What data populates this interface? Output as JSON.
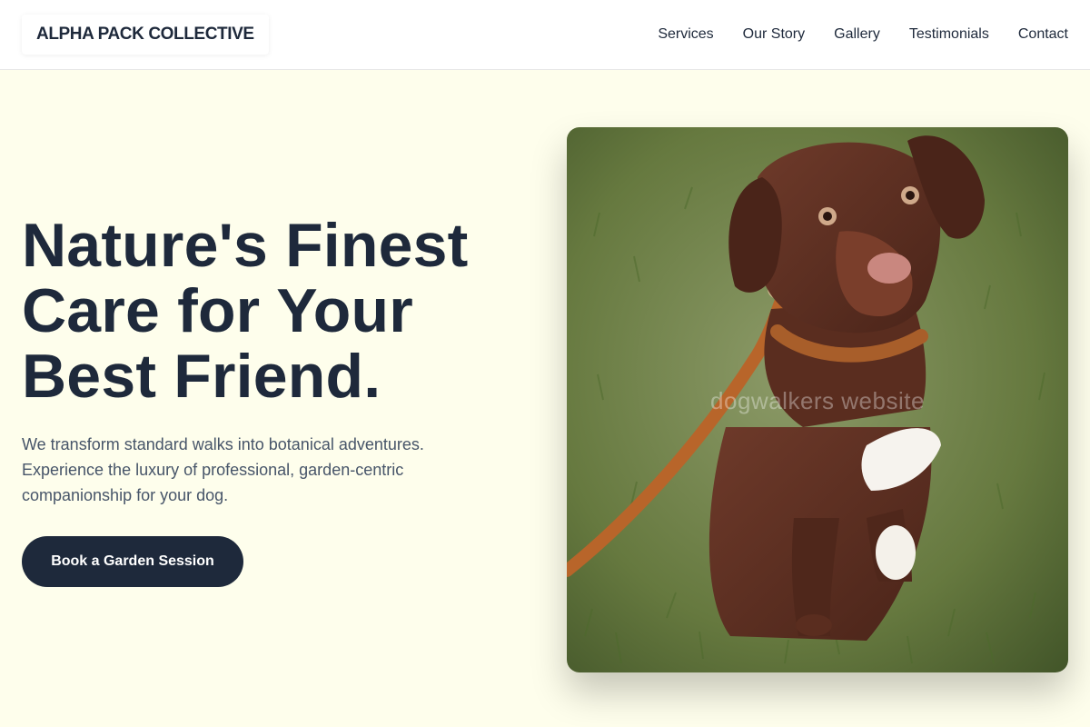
{
  "header": {
    "logo": "ALPHA PACK COLLECTIVE",
    "nav": [
      "Services",
      "Our Story",
      "Gallery",
      "Testimonials",
      "Contact"
    ]
  },
  "hero": {
    "title_lines": [
      "Nature's Finest",
      "Care for Your",
      "Best Friend."
    ],
    "subtitle_lines": [
      "We transform standard walks into botanical adventures.",
      "Experience the luxury of professional, garden-centric",
      "companionship for your dog."
    ],
    "cta_label": "Book a Garden Session"
  },
  "image": {
    "watermark": "dogwalkers website",
    "subject": "brown dog with leash sitting on grass"
  },
  "colors": {
    "background": "#fefeec",
    "text": "#1e293b",
    "muted": "#475569",
    "button": "#1e293b"
  }
}
